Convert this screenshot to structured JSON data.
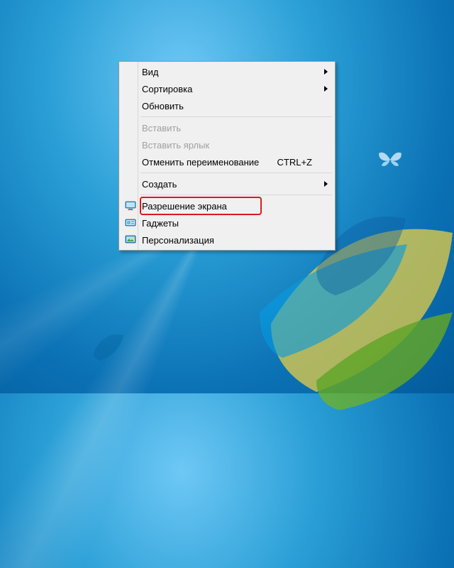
{
  "menu": {
    "items": [
      {
        "id": "view",
        "label": "Вид",
        "submenu": true,
        "enabled": true,
        "icon": null,
        "shortcut": ""
      },
      {
        "id": "sort",
        "label": "Сортировка",
        "submenu": true,
        "enabled": true,
        "icon": null,
        "shortcut": ""
      },
      {
        "id": "refresh",
        "label": "Обновить",
        "submenu": false,
        "enabled": true,
        "icon": null,
        "shortcut": ""
      },
      {
        "id": "sep1",
        "separator": true
      },
      {
        "id": "paste",
        "label": "Вставить",
        "submenu": false,
        "enabled": false,
        "icon": null,
        "shortcut": ""
      },
      {
        "id": "paste-shortcut",
        "label": "Вставить ярлык",
        "submenu": false,
        "enabled": false,
        "icon": null,
        "shortcut": ""
      },
      {
        "id": "undo-rename",
        "label": "Отменить переименование",
        "submenu": false,
        "enabled": true,
        "icon": null,
        "shortcut": "CTRL+Z"
      },
      {
        "id": "sep2",
        "separator": true
      },
      {
        "id": "new",
        "label": "Создать",
        "submenu": true,
        "enabled": true,
        "icon": null,
        "shortcut": ""
      },
      {
        "id": "sep3",
        "separator": true
      },
      {
        "id": "screen-resolution",
        "label": "Разрешение экрана",
        "submenu": false,
        "enabled": true,
        "icon": "monitor",
        "shortcut": "",
        "highlighted": true
      },
      {
        "id": "gadgets",
        "label": "Гаджеты",
        "submenu": false,
        "enabled": true,
        "icon": "gadget",
        "shortcut": ""
      },
      {
        "id": "personalize",
        "label": "Персонализация",
        "submenu": false,
        "enabled": true,
        "icon": "personalize",
        "shortcut": ""
      }
    ]
  },
  "highlight": {
    "target": "screen-resolution"
  },
  "colors": {
    "menu_bg": "#f0f0f0",
    "menu_border": "#979797",
    "disabled_text": "#a0a0a0",
    "highlight_border": "#e11818"
  }
}
